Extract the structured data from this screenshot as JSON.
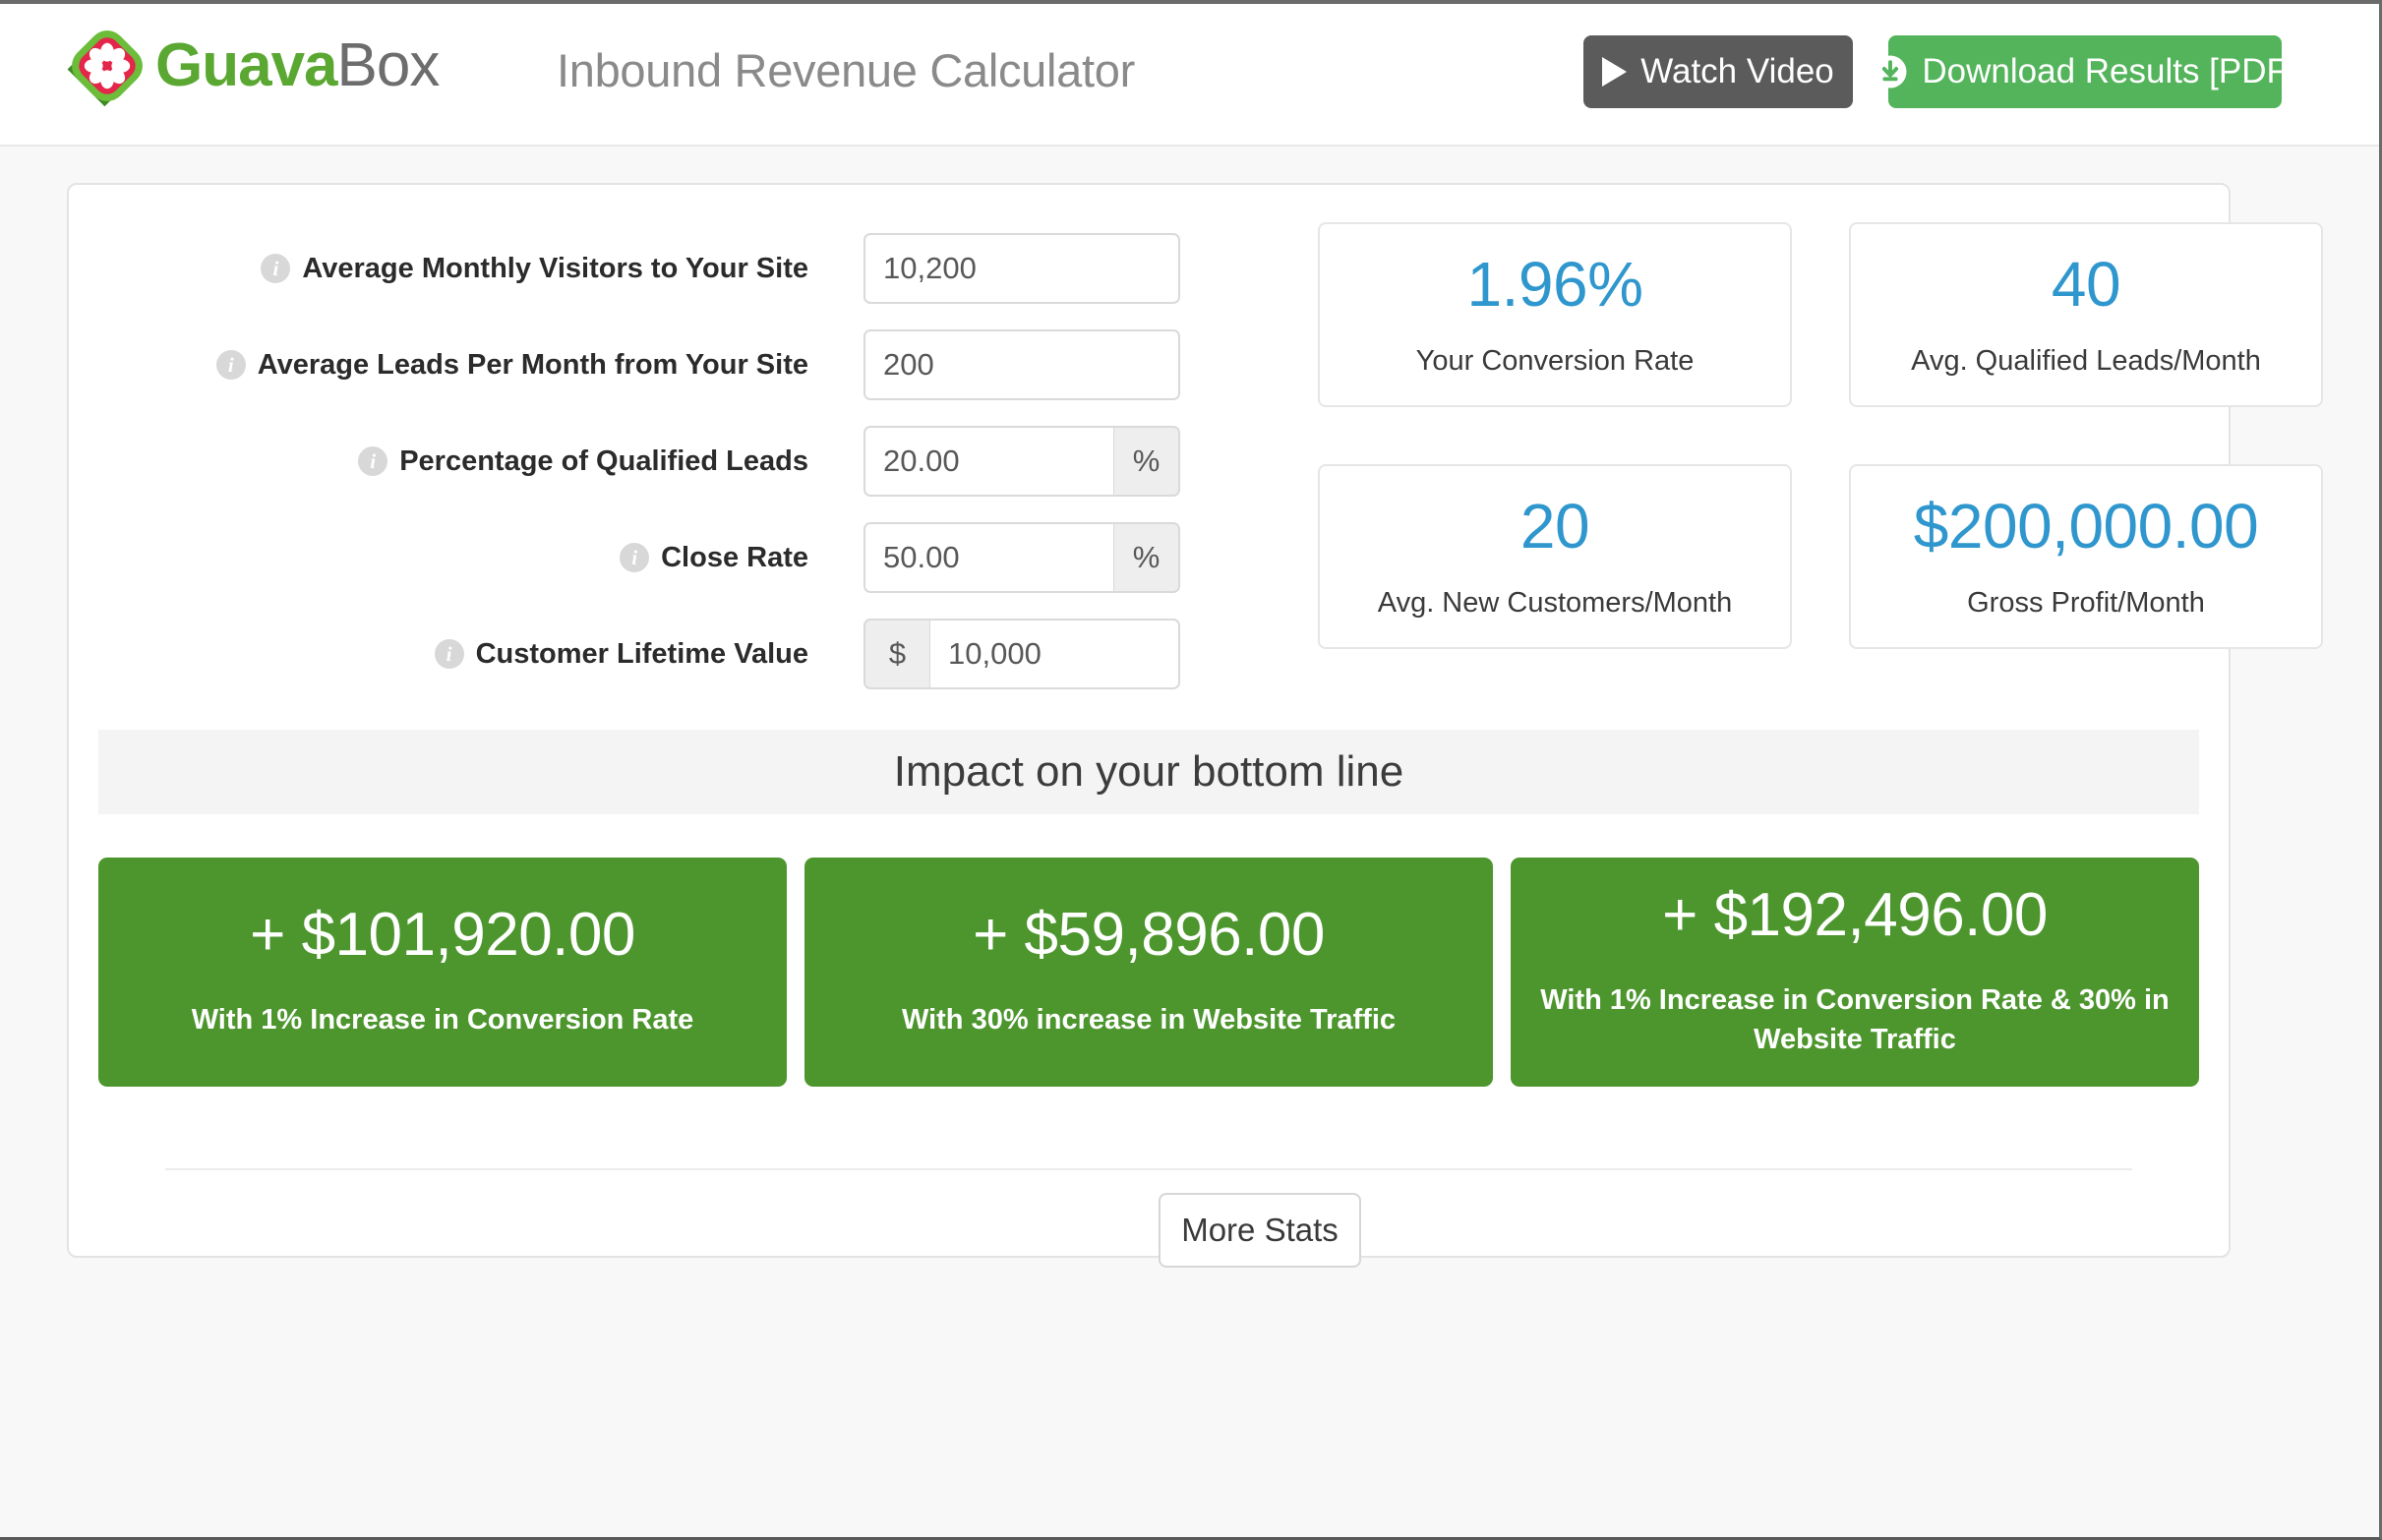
{
  "header": {
    "brand_guava": "Guava",
    "brand_box": "Box",
    "logo_icon": "guava-slice-logo",
    "app_title": "Inbound Revenue Calculator",
    "watch_video_label": "Watch Video",
    "watch_video_icon": "play-icon",
    "download_label": "Download Results [PDF]",
    "download_icon": "download-circle-icon",
    "watch_video_color": "#5b5b5b",
    "download_color": "#53b45b"
  },
  "form": {
    "info_glyph": "i",
    "rows": [
      {
        "label": "Average Monthly Visitors to Your Site",
        "value": "10,200",
        "placeholder": "10,200",
        "prefix": "",
        "suffix": ""
      },
      {
        "label": "Average Leads Per Month from Your Site",
        "value": "200",
        "placeholder": "200",
        "prefix": "",
        "suffix": ""
      },
      {
        "label": "Percentage of Qualified Leads",
        "value": "20.00",
        "placeholder": "20.00",
        "prefix": "",
        "suffix": "%"
      },
      {
        "label": "Close Rate",
        "value": "50.00",
        "placeholder": "50.00",
        "prefix": "",
        "suffix": "%"
      },
      {
        "label": "Customer Lifetime Value",
        "value": "10,000",
        "placeholder": "10,000",
        "prefix": "$",
        "suffix": ""
      }
    ]
  },
  "stats": {
    "accent_color": "#2f97cd",
    "cards": [
      {
        "value": "1.96%",
        "label": "Your Conversion Rate"
      },
      {
        "value": "40",
        "label": "Avg. Qualified Leads/Month"
      },
      {
        "value": "20",
        "label": "Avg. New Customers/Month"
      },
      {
        "value": "$200,000.00",
        "label": "Gross Profit/Month"
      }
    ]
  },
  "impact": {
    "title": "Impact on your bottom line",
    "box_color": "#4d962e",
    "boxes": [
      {
        "amount": "+ $101,920.00",
        "caption": "With 1% Increase in Conversion Rate"
      },
      {
        "amount": "+ $59,896.00",
        "caption": "With 30% increase in Website Traffic"
      },
      {
        "amount": "+ $192,496.00",
        "caption": "With 1% Increase in Conversion Rate & 30% in Website Traffic"
      }
    ]
  },
  "footer": {
    "more_stats_label": "More Stats"
  }
}
